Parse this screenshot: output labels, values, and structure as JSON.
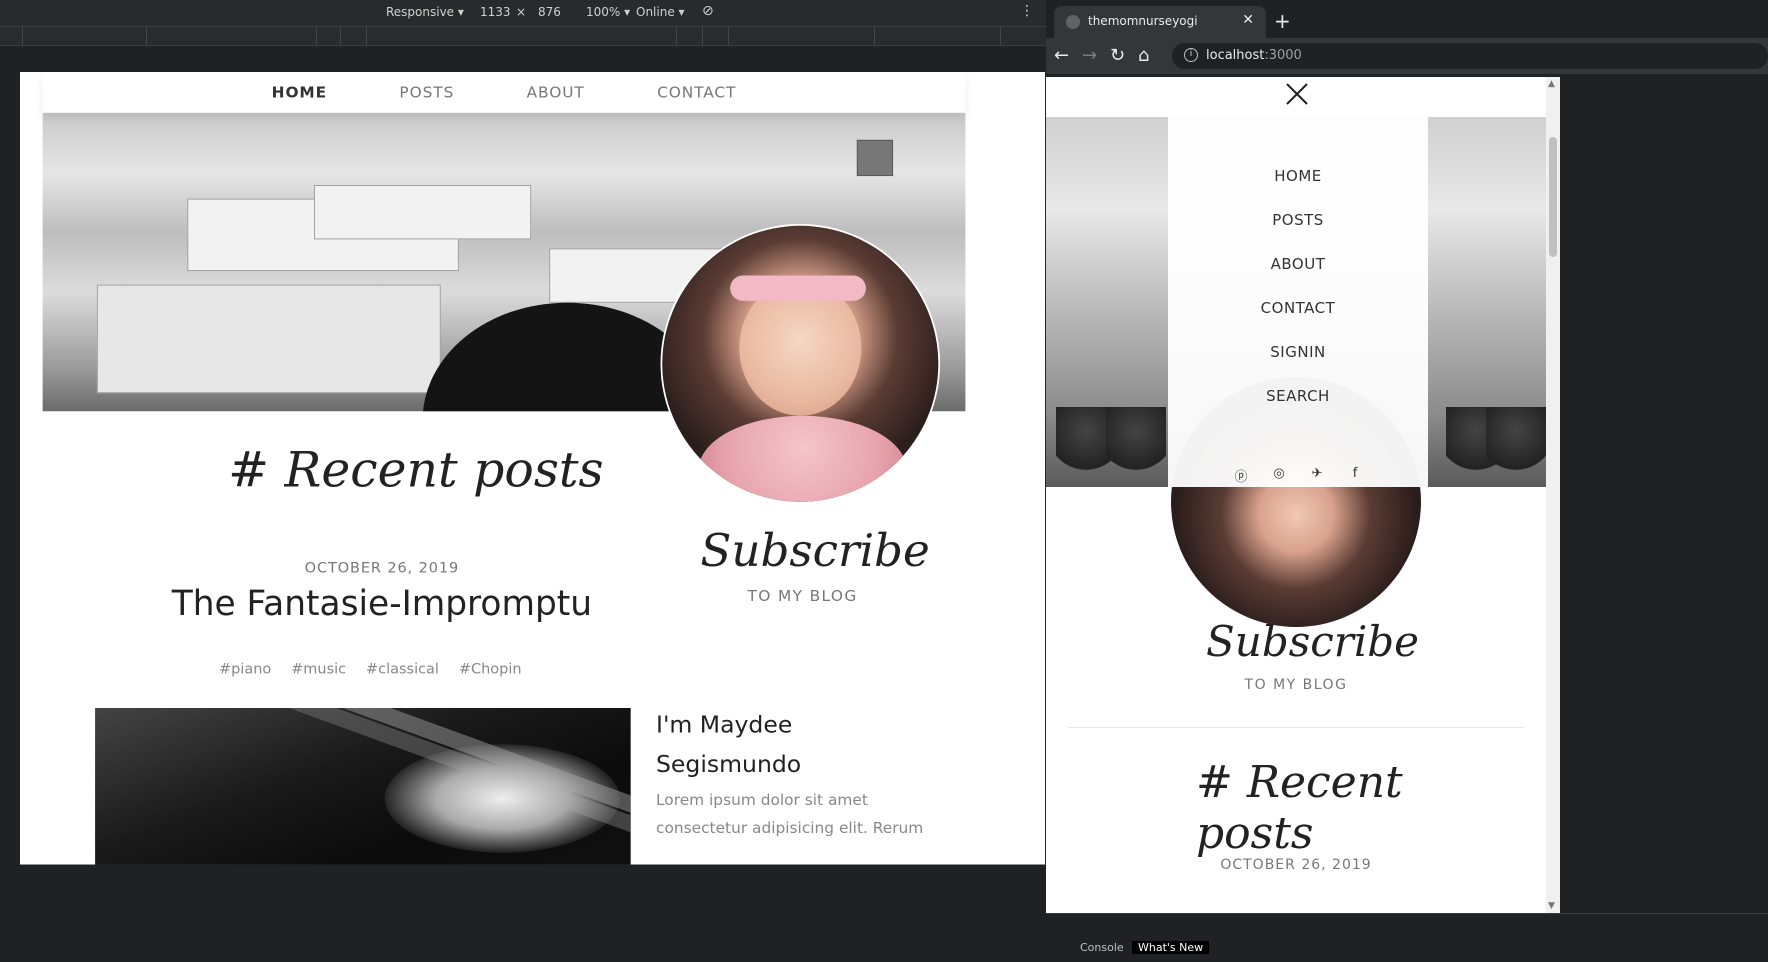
{
  "devtools": {
    "device": "Responsive",
    "width": "1133",
    "times": "×",
    "height": "876",
    "zoom": "100%",
    "network": "Online",
    "more_icon": "kebab-icon",
    "rotate_icon": "rotate-icon"
  },
  "site": {
    "nav": [
      "HOME",
      "POSTS",
      "ABOUT",
      "CONTACT"
    ],
    "recent_title": "# Recent posts",
    "subscribe_title": "Subscribe",
    "subscribe_sub": "TO MY BLOG",
    "post": {
      "date": "OCTOBER 26, 2019",
      "title": "The Fantasie-Impromptu",
      "tags": [
        "#piano",
        "#music",
        "#classical",
        "#Chopin"
      ]
    },
    "about": {
      "name_line1": "I'm Maydee",
      "name_line2": "Segismundo",
      "text": "Lorem ipsum dolor sit amet consectetur adipisicing elit. Rerum"
    }
  },
  "browser": {
    "tab_title": "themomnurseyogi",
    "url_host": "localhost",
    "url_port": ":3000",
    "new_tab": "+",
    "close_tab": "✕"
  },
  "mobile": {
    "menu": [
      "HOME",
      "POSTS",
      "ABOUT",
      "CONTACT",
      "SIGNIN",
      "SEARCH"
    ],
    "socials": [
      "pinterest-icon",
      "instagram-icon",
      "twitter-icon",
      "facebook-icon"
    ],
    "subscribe_title": "Subscribe",
    "subscribe_sub": "TO MY BLOG",
    "recent_title": "# Recent posts",
    "date": "OCTOBER 26, 2019"
  },
  "bottom_tabs": [
    "Console",
    "What's New"
  ]
}
